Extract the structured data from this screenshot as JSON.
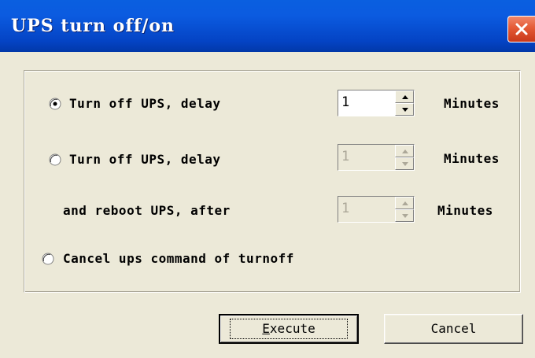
{
  "window": {
    "title": "UPS turn off/on",
    "close_icon": "close-icon"
  },
  "options": [
    {
      "label": "Turn off UPS, delay",
      "selected": true,
      "spin_value": "1",
      "unit": "Minutes",
      "enabled": true
    },
    {
      "label": "Turn off UPS, delay",
      "selected": false,
      "spin_value": "1",
      "unit": "Minutes",
      "enabled": false,
      "sub_label": "and reboot UPS, after",
      "sub_spin_value": "1",
      "sub_unit": "Minutes"
    },
    {
      "label": "Cancel ups command of turnoff",
      "selected": false
    }
  ],
  "buttons": {
    "execute_access_key": "E",
    "execute_rest": "xecute",
    "cancel": "Cancel"
  },
  "colors": {
    "titlebar": "#0B5BE0",
    "close_button": "#E45A36",
    "dialog_bg": "#ECE9D8"
  }
}
